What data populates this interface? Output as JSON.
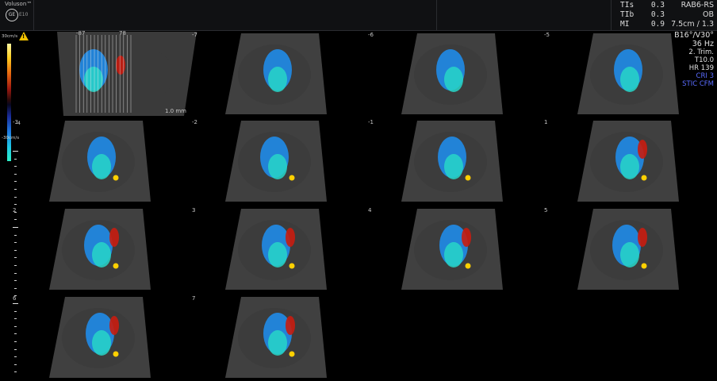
{
  "header": {
    "brand": "Voluson™",
    "brand_model": "E10",
    "logo": "GE",
    "indices": [
      {
        "label": "TIs",
        "value": "0.3"
      },
      {
        "label": "TIb",
        "value": "0.3"
      },
      {
        "label": "MI",
        "value": "0.9"
      }
    ],
    "probe": "RAB6-RS",
    "preset": "OB",
    "depth": "7.5cm / 1.3"
  },
  "params": {
    "angle": "B16°/V30°",
    "rate": "36 Hz",
    "trimester": "2. Trim.",
    "tissue": "T10.0",
    "hr": "HR 139",
    "cri": "CRI 3",
    "mode": "STIC CFM"
  },
  "color_scale": {
    "top_label": "30cm/s",
    "bottom_label": "-30cm/s",
    "mark": "-4",
    "gradient_top": "#fff7a0",
    "gradient_bottom": "#2cf0c8"
  },
  "reference_image": {
    "left_marker": "-87",
    "right_marker": "78",
    "scale_label": "1.0 mm"
  },
  "frames": [
    {
      "index": "-7"
    },
    {
      "index": "-6"
    },
    {
      "index": "-5"
    },
    {
      "index": "-3"
    },
    {
      "index": "-2"
    },
    {
      "index": "-1"
    },
    {
      "index": "1"
    },
    {
      "index": "2"
    },
    {
      "index": "3"
    },
    {
      "index": "4"
    },
    {
      "index": "5"
    },
    {
      "index": "6"
    },
    {
      "index": "7"
    }
  ],
  "colors": {
    "flow_blue": "#1f8be8",
    "flow_cyan": "#27d6c8",
    "flow_red": "#c81c10",
    "flow_yellow": "#ffd000",
    "tissue": "#6a6a6a"
  }
}
